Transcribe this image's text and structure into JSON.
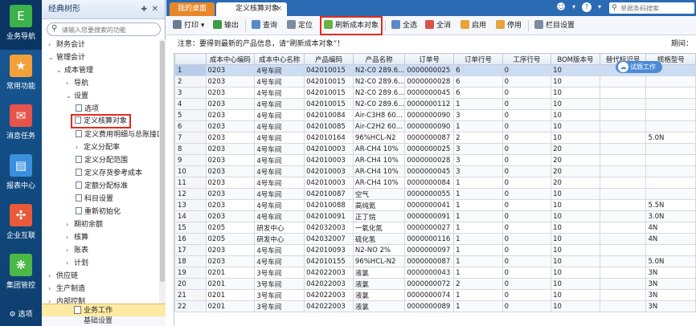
{
  "leftnav": {
    "items": [
      {
        "label": "业务导航",
        "icon": "grid-app-icon"
      },
      {
        "label": "常用功能",
        "icon": "star-icon"
      },
      {
        "label": "消息任务",
        "icon": "mail-icon"
      },
      {
        "label": "报表中心",
        "icon": "report-icon"
      },
      {
        "label": "企业互联",
        "icon": "connect-icon"
      },
      {
        "label": "集团管控",
        "icon": "group-icon"
      }
    ],
    "options_label": "选项",
    "colors": {
      "bg": "#1a5c9a",
      "nav1": "#3bb24a",
      "nav2": "#f2a13a",
      "nav3": "#e8534a",
      "nav4": "#3b8fdc",
      "nav5": "#e85a3a",
      "nav6": "#4cb848"
    }
  },
  "treepanel": {
    "title": "经典树形",
    "search_placeholder": "请输入您要搜索的功能",
    "nodes": [
      {
        "label": "财务会计"
      },
      {
        "label": "管理会计"
      },
      {
        "label": "成本管理"
      },
      {
        "label": "导航"
      },
      {
        "label": "设置"
      },
      {
        "label": "选项"
      },
      {
        "label": "定义核算对象"
      },
      {
        "label": "定义费用明细与总账接口"
      },
      {
        "label": "定义分配率"
      },
      {
        "label": "定义分配范围"
      },
      {
        "label": "定义存货参考成本"
      },
      {
        "label": "定额分配标准"
      },
      {
        "label": "科目设置"
      },
      {
        "label": "重新初始化"
      },
      {
        "label": "期初余额"
      },
      {
        "label": "核算"
      },
      {
        "label": "账表"
      },
      {
        "label": "计划"
      },
      {
        "label": "供应链"
      },
      {
        "label": "生产制造"
      },
      {
        "label": "内部控制"
      }
    ],
    "biz_work": "业务工作",
    "biz_rules": "基础设置"
  },
  "tabs": {
    "home": "我的桌面",
    "current": "定义核算对象"
  },
  "topright": {
    "search_placeholder": "单据条码搜索"
  },
  "toolbar": {
    "print": "打印",
    "export": "输出",
    "query": "查询",
    "locate": "定位",
    "refresh": "刷新成本对象",
    "select_all": "全选",
    "deselect_all": "全消",
    "enable": "启用",
    "disable": "停用",
    "columns": "栏目设置"
  },
  "notice": {
    "text": "注意：要得到最新的产品信息，请“刷新成本对象”！",
    "period": "期间："
  },
  "badge": "试题工作",
  "grid": {
    "headers": [
      "成本中心编码",
      "成本中心名称",
      "产品编码",
      "产品名称",
      "订单号",
      "订单行号",
      "工序行号",
      "BOM版本号",
      "替代标识号",
      "规格型号"
    ],
    "rows": [
      [
        "1",
        "0203",
        "4号车间",
        "042010015",
        "N2-C0 289.6...",
        "0000000025",
        "6",
        "0",
        "10",
        "",
        ""
      ],
      [
        "2",
        "0203",
        "4号车间",
        "042010015",
        "N2-C0 289.6...",
        "0000000028",
        "6",
        "0",
        "10",
        "",
        ""
      ],
      [
        "3",
        "0203",
        "4号车间",
        "042010015",
        "N2-C0 289.6...",
        "0000000045",
        "6",
        "0",
        "10",
        "",
        ""
      ],
      [
        "4",
        "0203",
        "4号车间",
        "042010015",
        "N2-C0 289.6...",
        "0000000112",
        "1",
        "0",
        "10",
        "",
        ""
      ],
      [
        "5",
        "0203",
        "4号车间",
        "042010084",
        "Air-C3H8 60...",
        "0000000090",
        "3",
        "0",
        "10",
        "",
        ""
      ],
      [
        "6",
        "0203",
        "4号车间",
        "042010085",
        "Air-C2H2 60...",
        "0000000090",
        "1",
        "0",
        "10",
        "",
        ""
      ],
      [
        "7",
        "0203",
        "4号车间",
        "042010164",
        "96%HCL-N2",
        "0000000087",
        "2",
        "0",
        "10",
        "",
        "5.0N"
      ],
      [
        "8",
        "0203",
        "4号车间",
        "042010003",
        "AR-CH4 10%",
        "0000000025",
        "3",
        "0",
        "20",
        "",
        ""
      ],
      [
        "9",
        "0203",
        "4号车间",
        "042010003",
        "AR-CH4 10%",
        "0000000028",
        "3",
        "0",
        "20",
        "",
        ""
      ],
      [
        "10",
        "0203",
        "4号车间",
        "042010003",
        "AR-CH4 10%",
        "0000000045",
        "3",
        "0",
        "20",
        "",
        ""
      ],
      [
        "11",
        "0203",
        "4号车间",
        "042010003",
        "AR-CH4 10%",
        "0000000084",
        "1",
        "0",
        "20",
        "",
        ""
      ],
      [
        "12",
        "0203",
        "4号车间",
        "042010087",
        "空气",
        "0000000055",
        "1",
        "0",
        "10",
        "",
        ""
      ],
      [
        "13",
        "0203",
        "4号车间",
        "042010088",
        "高纯氦",
        "0000000041",
        "1",
        "0",
        "10",
        "",
        "5.5N"
      ],
      [
        "14",
        "0203",
        "4号车间",
        "042010091",
        "正丁烷",
        "0000000091",
        "1",
        "0",
        "10",
        "",
        "3.0N"
      ],
      [
        "15",
        "0205",
        "研发中心",
        "042032003",
        "一氧化氮",
        "0000000027",
        "1",
        "0",
        "10",
        "",
        "4N"
      ],
      [
        "16",
        "0205",
        "研发中心",
        "042032007",
        "硫化氢",
        "0000000116",
        "1",
        "0",
        "10",
        "",
        "4N"
      ],
      [
        "17",
        "0203",
        "4号车间",
        "042010093",
        "N2-NO 2%",
        "0000000097",
        "1",
        "0",
        "10",
        "",
        ""
      ],
      [
        "18",
        "0203",
        "4号车间",
        "042010155",
        "96%HCL-N2",
        "0000000087",
        "1",
        "0",
        "10",
        "",
        "5.0N"
      ],
      [
        "19",
        "0201",
        "3号车间",
        "042022003",
        "液氯",
        "0000000043",
        "1",
        "0",
        "10",
        "",
        "3N"
      ],
      [
        "20",
        "0201",
        "3号车间",
        "042022003",
        "液氯",
        "0000000072",
        "2",
        "0",
        "10",
        "",
        "3N"
      ],
      [
        "21",
        "0201",
        "3号车间",
        "042022003",
        "液氯",
        "0000000074",
        "1",
        "0",
        "10",
        "",
        "3N"
      ],
      [
        "22",
        "0201",
        "3号车间",
        "042022003",
        "液氯",
        "0000000089",
        "1",
        "0",
        "10",
        "",
        "3N"
      ]
    ]
  }
}
